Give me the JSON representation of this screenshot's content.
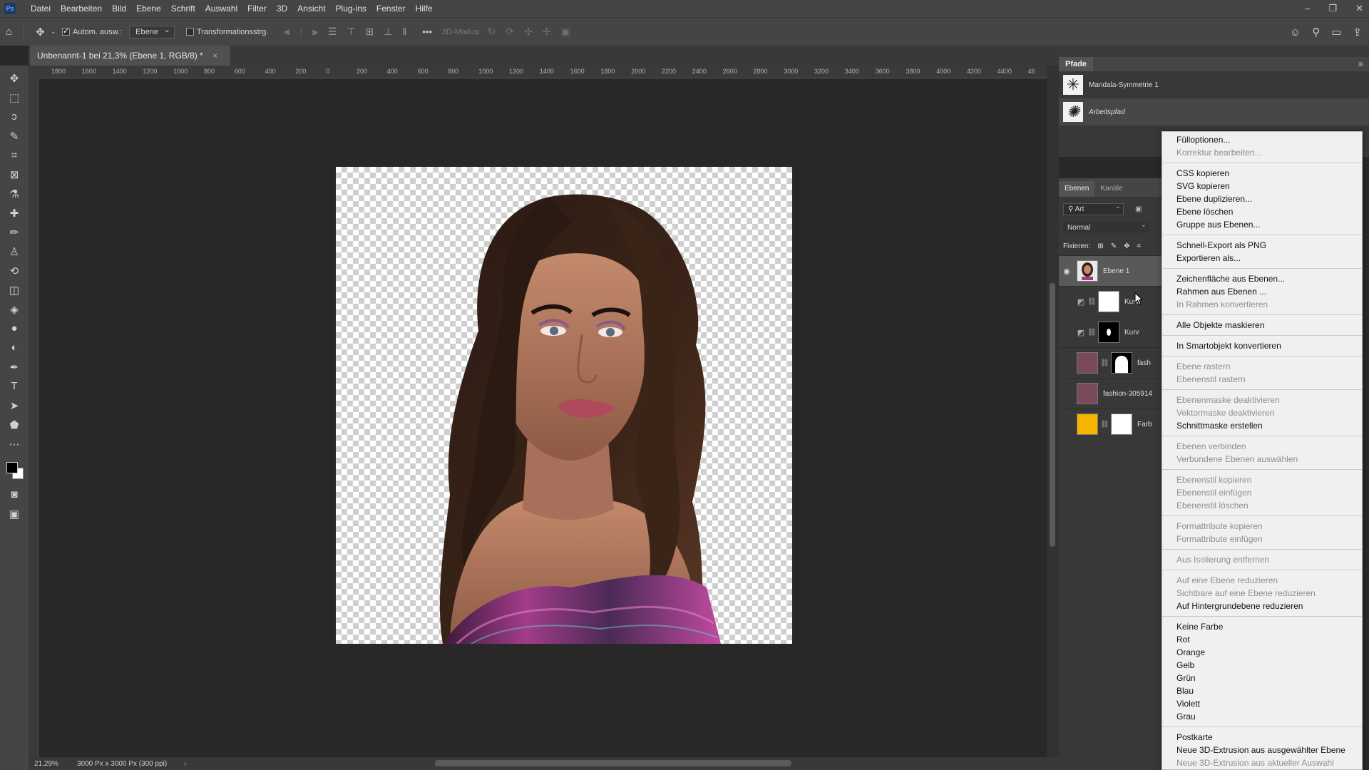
{
  "app": {
    "logo": "Ps"
  },
  "menubar": [
    "Datei",
    "Bearbeiten",
    "Bild",
    "Ebene",
    "Schrift",
    "Auswahl",
    "Filter",
    "3D",
    "Ansicht",
    "Plug-ins",
    "Fenster",
    "Hilfe"
  ],
  "window_controls": {
    "minimize": "–",
    "restore": "❐",
    "close": "✕"
  },
  "options": {
    "auto_select_label": "Autom. ausw.:",
    "auto_select_target": "Ebene",
    "transform_label": "Transformationsstrg.",
    "mode3d_label": "3D-Modus:",
    "more": "•••"
  },
  "document": {
    "tab_title": "Unbenannt-1 bei 21,3% (Ebene 1, RGB/8) *",
    "zoom": "21,29%",
    "doc_info": "3000 Px x 3000 Px (300 ppi)"
  },
  "ruler_labels": [
    "1800",
    "1600",
    "1400",
    "1200",
    "1000",
    "800",
    "600",
    "400",
    "200",
    "0",
    "200",
    "400",
    "600",
    "800",
    "1000",
    "1200",
    "1400",
    "1600",
    "1800",
    "2000",
    "2200",
    "2400",
    "2600",
    "2800",
    "3000",
    "3200",
    "3400",
    "3600",
    "3800",
    "4000",
    "4200",
    "4400",
    "46"
  ],
  "paths_panel": {
    "title": "Pfade",
    "paths": [
      "Mandala-Symmetrie 1",
      "Arbeitspfad"
    ]
  },
  "layers_panel": {
    "tabs": [
      "Ebenen",
      "Kanäle"
    ],
    "filter_label": "Art",
    "blend_mode": "Normal",
    "lock_label": "Fixieren:",
    "layers": [
      {
        "name": "Ebene 1",
        "selected": true
      },
      {
        "name": "Kurv"
      },
      {
        "name": "Kurv"
      },
      {
        "name": "fash"
      },
      {
        "name": "fashion-305914"
      },
      {
        "name": "Farb"
      }
    ]
  },
  "context_menu": [
    {
      "label": "Fülloptionen...",
      "enabled": true
    },
    {
      "label": "Korrektur bearbeiten...",
      "enabled": false
    },
    {
      "sep": true
    },
    {
      "label": "CSS kopieren",
      "enabled": true
    },
    {
      "label": "SVG kopieren",
      "enabled": true
    },
    {
      "label": "Ebene duplizieren...",
      "enabled": true
    },
    {
      "label": "Ebene löschen",
      "enabled": true
    },
    {
      "label": "Gruppe aus Ebenen...",
      "enabled": true
    },
    {
      "sep": true
    },
    {
      "label": "Schnell-Export als PNG",
      "enabled": true
    },
    {
      "label": "Exportieren als...",
      "enabled": true
    },
    {
      "sep": true
    },
    {
      "label": "Zeichenfläche aus Ebenen...",
      "enabled": true
    },
    {
      "label": "Rahmen aus Ebenen ...",
      "enabled": true
    },
    {
      "label": "In Rahmen konvertieren",
      "enabled": false
    },
    {
      "sep": true
    },
    {
      "label": "Alle Objekte maskieren",
      "enabled": true
    },
    {
      "sep": true
    },
    {
      "label": "In Smartobjekt konvertieren",
      "enabled": true
    },
    {
      "sep": true
    },
    {
      "label": "Ebene rastern",
      "enabled": false
    },
    {
      "label": "Ebenenstil rastern",
      "enabled": false
    },
    {
      "sep": true
    },
    {
      "label": "Ebenenmaske deaktivieren",
      "enabled": false
    },
    {
      "label": "Vektormaske deaktivieren",
      "enabled": false
    },
    {
      "label": "Schnittmaske erstellen",
      "enabled": true
    },
    {
      "sep": true
    },
    {
      "label": "Ebenen verbinden",
      "enabled": false
    },
    {
      "label": "Verbundene Ebenen auswählen",
      "enabled": false
    },
    {
      "sep": true
    },
    {
      "label": "Ebenenstil kopieren",
      "enabled": false
    },
    {
      "label": "Ebenenstil einfügen",
      "enabled": false
    },
    {
      "label": "Ebenenstil löschen",
      "enabled": false
    },
    {
      "sep": true
    },
    {
      "label": "Formattribute kopieren",
      "enabled": false
    },
    {
      "label": "Formattribute einfügen",
      "enabled": false
    },
    {
      "sep": true
    },
    {
      "label": "Aus Isolierung entfernen",
      "enabled": false
    },
    {
      "sep": true
    },
    {
      "label": "Auf eine Ebene reduzieren",
      "enabled": false
    },
    {
      "label": "Sichtbare auf eine Ebene reduzieren",
      "enabled": false
    },
    {
      "label": "Auf Hintergrundebene reduzieren",
      "enabled": true
    },
    {
      "sep": true
    },
    {
      "label": "Keine Farbe",
      "enabled": true
    },
    {
      "label": "Rot",
      "enabled": true
    },
    {
      "label": "Orange",
      "enabled": true
    },
    {
      "label": "Gelb",
      "enabled": true
    },
    {
      "label": "Grün",
      "enabled": true
    },
    {
      "label": "Blau",
      "enabled": true
    },
    {
      "label": "Violett",
      "enabled": true
    },
    {
      "label": "Grau",
      "enabled": true
    },
    {
      "sep": true
    },
    {
      "label": "Postkarte",
      "enabled": true
    },
    {
      "label": "Neue 3D-Extrusion aus ausgewählter Ebene",
      "enabled": true
    },
    {
      "label": "Neue 3D-Extrusion aus aktueller Auswahl",
      "enabled": false
    }
  ],
  "colors": {
    "foreground": "#000000",
    "background": "#ffffff",
    "fill_layer": "#f4b400"
  }
}
